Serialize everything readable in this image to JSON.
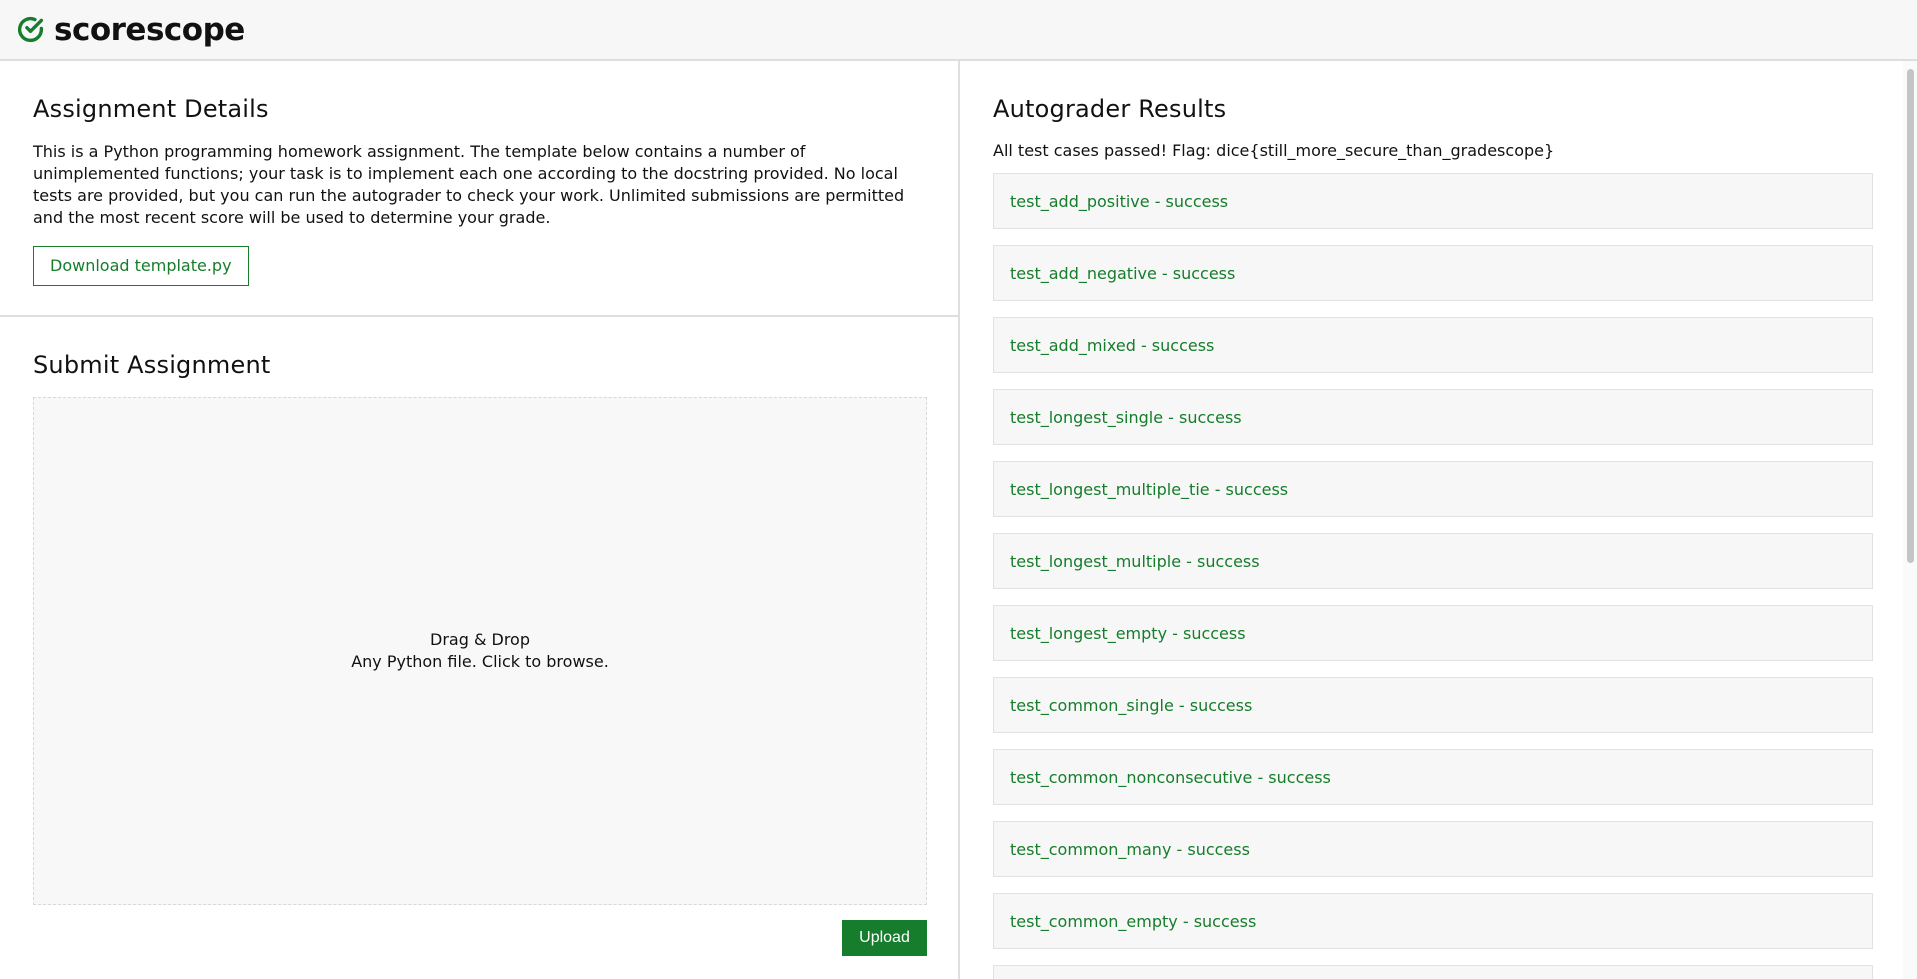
{
  "app": {
    "name": "scorescope",
    "logo_icon": "check-circle-icon",
    "accent_color": "#157d2b"
  },
  "details": {
    "title": "Assignment Details",
    "description": "This is a Python programming homework assignment. The template below contains a number of unimplemented functions; your task is to implement each one according to the docstring provided. No local tests are provided, but you can run the autograder to check your work. Unlimited submissions are permitted and the most recent score will be used to determine your grade.",
    "download_label": "Download template.py"
  },
  "submit": {
    "title": "Submit Assignment",
    "drop_title": "Drag & Drop",
    "drop_hint": "Any Python file. Click to browse.",
    "upload_label": "Upload"
  },
  "results": {
    "title": "Autograder Results",
    "flag_text": "All test cases passed! Flag: dice{still_more_secure_than_gradescope}",
    "items": [
      "test_add_positive - success",
      "test_add_negative - success",
      "test_add_mixed - success",
      "test_longest_single - success",
      "test_longest_multiple_tie - success",
      "test_longest_multiple - success",
      "test_longest_empty - success",
      "test_common_single - success",
      "test_common_nonconsecutive - success",
      "test_common_many - success",
      "test_common_empty - success",
      ""
    ]
  }
}
